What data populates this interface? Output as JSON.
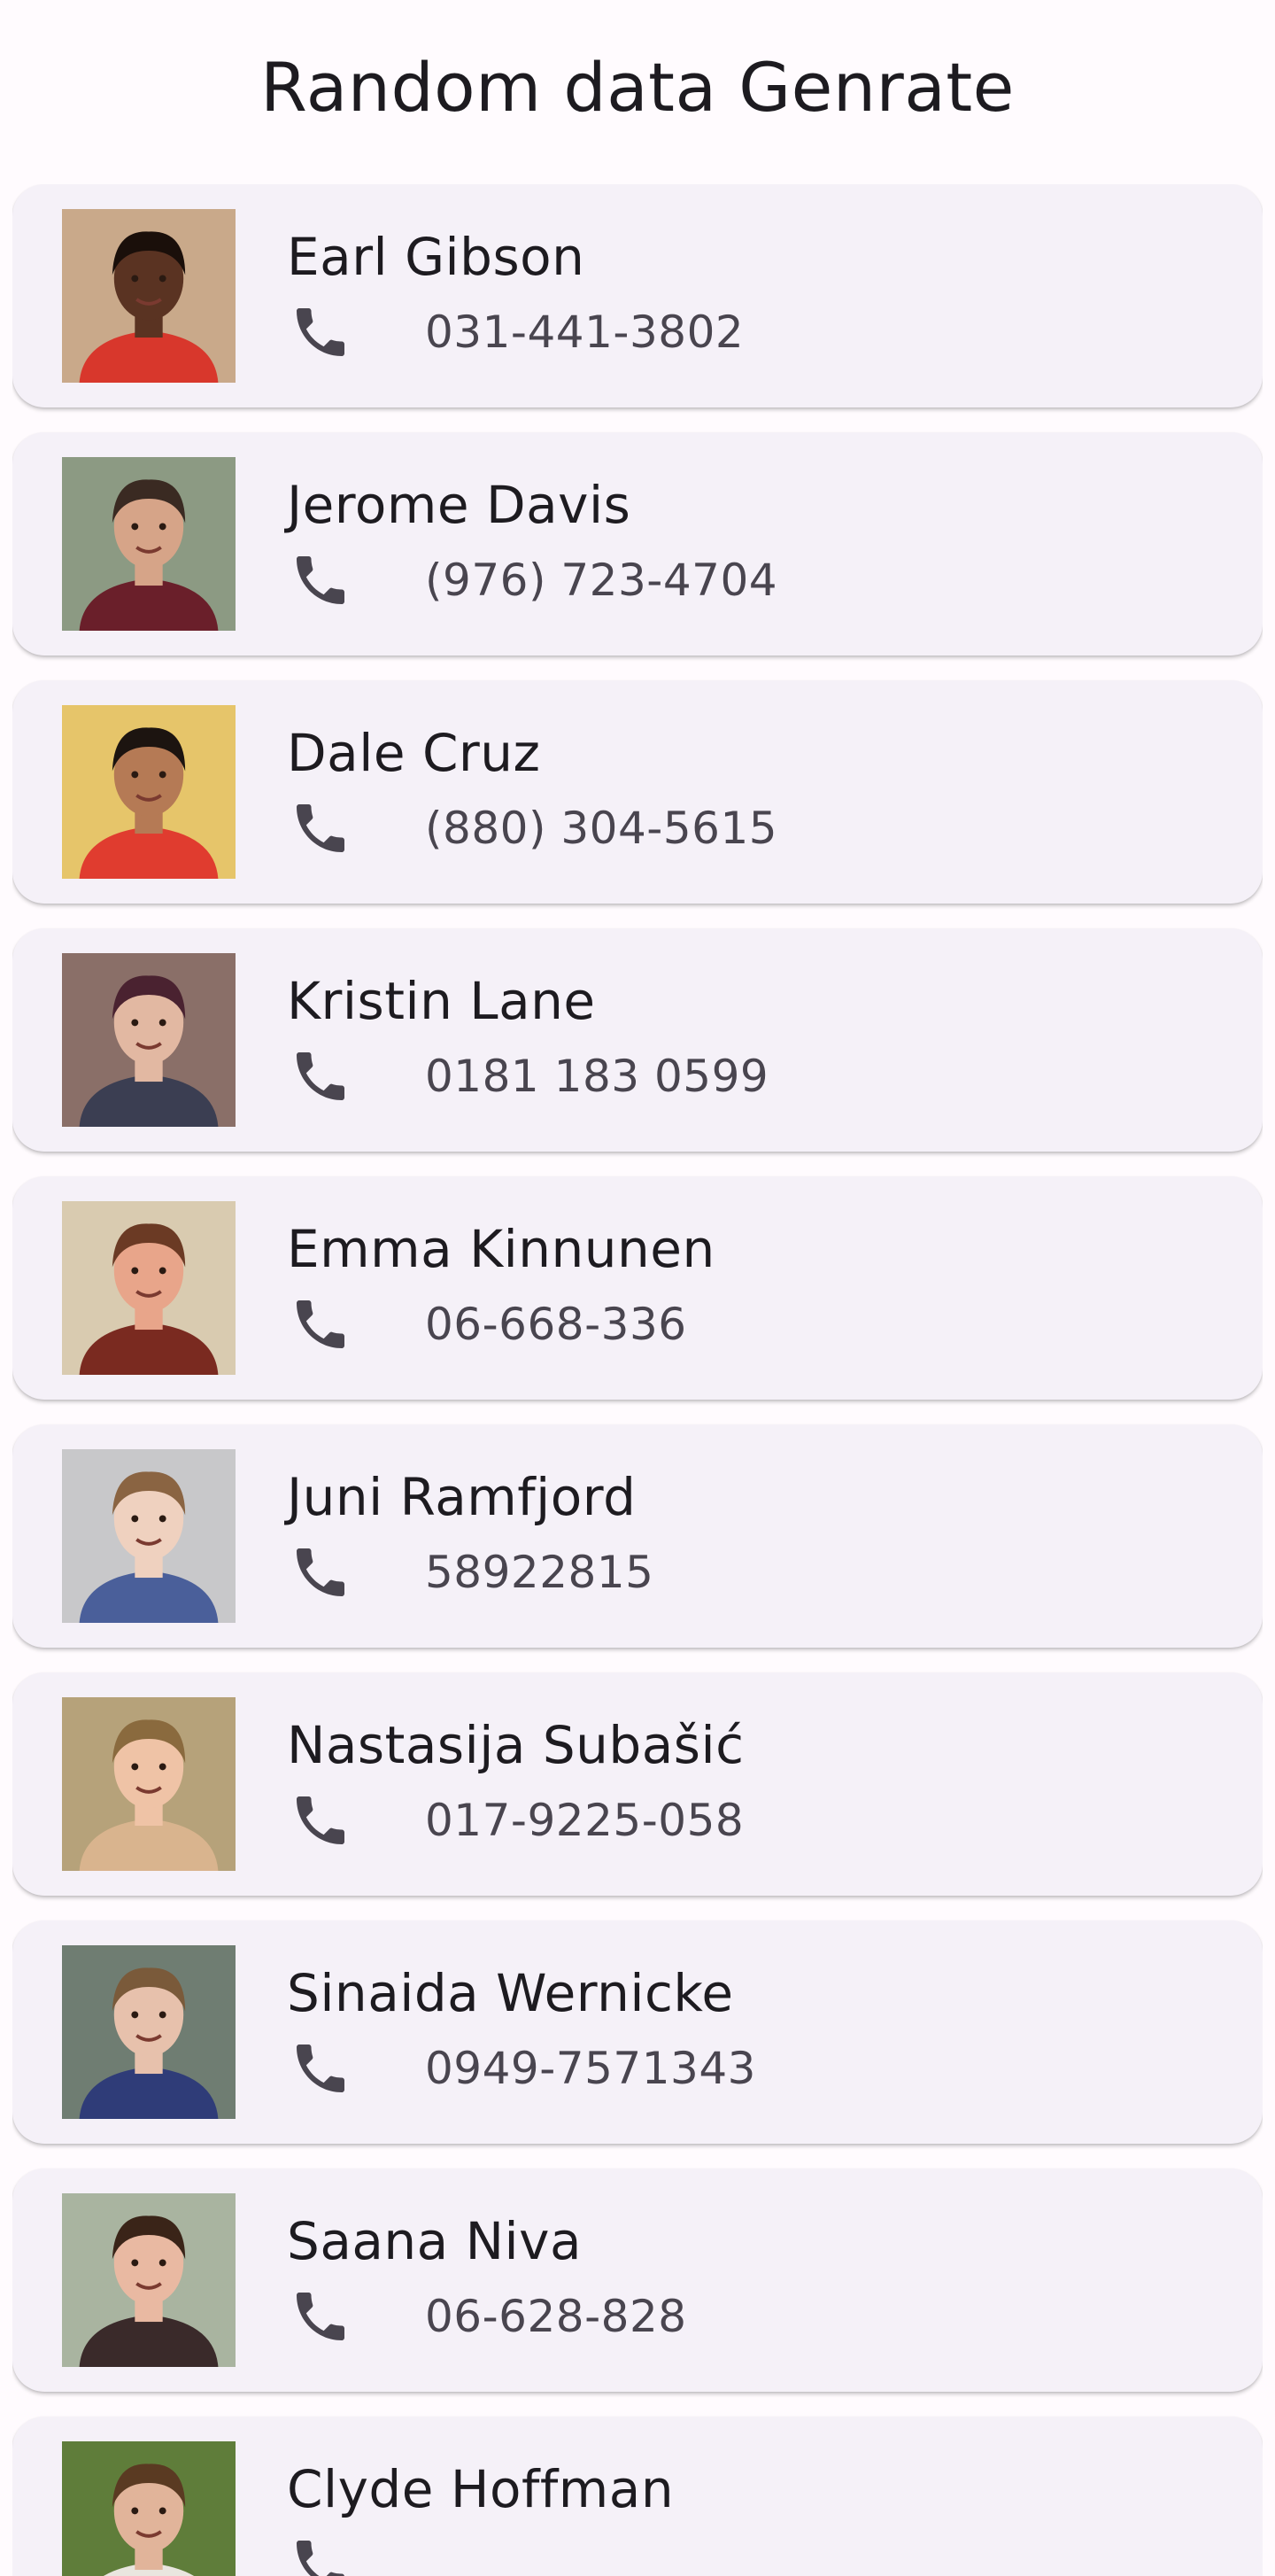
{
  "app_bar": {
    "title": "Random data Genrate"
  },
  "contacts": [
    {
      "name": "Earl Gibson",
      "phone": "031-441-3802",
      "bg": "#c9a98a",
      "skin": "#5a3322",
      "hair": "#1a0f0a",
      "shirt": "#d8372c"
    },
    {
      "name": "Jerome Davis",
      "phone": "(976) 723-4704",
      "bg": "#8c9a83",
      "skin": "#d6a488",
      "hair": "#3a2a22",
      "shirt": "#6a1f2a"
    },
    {
      "name": "Dale Cruz",
      "phone": "(880) 304-5615",
      "bg": "#e6c56a",
      "skin": "#b57a55",
      "hair": "#1c1410",
      "shirt": "#e03c2f"
    },
    {
      "name": "Kristin Lane",
      "phone": "0181 183 0599",
      "bg": "#8a6f68",
      "skin": "#e2b8a2",
      "hair": "#4a2230",
      "shirt": "#3b3e52"
    },
    {
      "name": "Emma Kinnunen",
      "phone": "06-668-336",
      "bg": "#d9cbb0",
      "skin": "#e8a58a",
      "hair": "#6b3a24",
      "shirt": "#7a2a20"
    },
    {
      "name": "Juni Ramfjord",
      "phone": "58922815",
      "bg": "#c8c8ca",
      "skin": "#efd1bf",
      "hair": "#8a6442",
      "shirt": "#4a5f9a"
    },
    {
      "name": "Nastasija Subašić",
      "phone": "017-9225-058",
      "bg": "#b6a27a",
      "skin": "#efc3a6",
      "hair": "#8a6a3e",
      "shirt": "#d9b48e"
    },
    {
      "name": "Sinaida Wernicke",
      "phone": "0949-7571343",
      "bg": "#6f7d72",
      "skin": "#e7c1ac",
      "hair": "#7a5a3a",
      "shirt": "#2f3c78"
    },
    {
      "name": "Saana Niva",
      "phone": "06-628-828",
      "bg": "#a9b4a0",
      "skin": "#e9b9a2",
      "hair": "#3a2418",
      "shirt": "#3a2a2a"
    },
    {
      "name": "Clyde Hoffman",
      "phone": "",
      "bg": "#5f7d3a",
      "skin": "#e1b49a",
      "hair": "#5a3a22",
      "shirt": "#e9e6df"
    }
  ],
  "icons": {
    "phone": "phone-icon",
    "avatar": "avatar-photo"
  }
}
